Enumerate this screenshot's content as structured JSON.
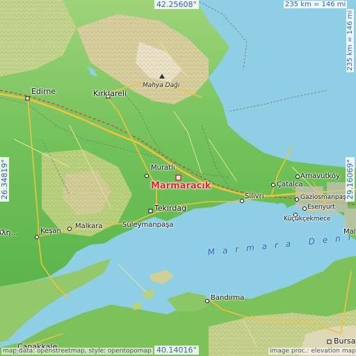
{
  "colors": {
    "water": "#8fcfe6",
    "lowland": "#5bb54a",
    "plain": "#8ccf6a",
    "hill": "#c9d99a",
    "highland": "#d9c9a0",
    "peak": "#f2ece0",
    "road_major": "#f3c23b",
    "road_minor": "#e7e0a0",
    "rail": "#d04a2e",
    "border": "#777777",
    "marker": "#e8202a",
    "coord_text": "#2d63b4"
  },
  "target": {
    "name": "Marmaracık",
    "marker_icon": "square-marker-icon"
  },
  "places": [
    {
      "name": "Edirne",
      "dot": true
    },
    {
      "name": "Kırklareli",
      "dot": true
    },
    {
      "name": "Muratlı",
      "dot": true
    },
    {
      "name": "Tekirdağ",
      "dot": true
    },
    {
      "name": "Süleymanpaşa",
      "dot": false
    },
    {
      "name": "Malkara",
      "dot": true
    },
    {
      "name": "Keşan",
      "dot": true
    },
    {
      "name": "Silivri",
      "dot": true
    },
    {
      "name": "Çatalca",
      "dot": true
    },
    {
      "name": "Arnavutköy",
      "dot": true
    },
    {
      "name": "Esenyurt",
      "dot": true
    },
    {
      "name": "Gaziosmanpaşa",
      "dot": true
    },
    {
      "name": "Küçükçekmece",
      "dot": true
    },
    {
      "name": "Bandırma",
      "dot": true
    },
    {
      "name": "Bursa",
      "dot": true
    },
    {
      "name": "Çanakkale",
      "dot": true
    },
    {
      "name": "Maltepe",
      "dot": false
    },
    {
      "name": "...όλη",
      "dot": true
    }
  ],
  "mountain": {
    "name": "Mahya Dağı",
    "icon": "peak-triangle-icon"
  },
  "sea_label": "Marmara Deniz",
  "coords": {
    "top": "42.25608°",
    "bottom": "40.14016°",
    "left": "26.34819°",
    "right": "29.16069°"
  },
  "scale": {
    "top": "235 km = 146 mi",
    "right": "235 km = 146 mi"
  },
  "attribution": {
    "left": "map data: openstreetmap, style: opentopomap",
    "right": "image proc.: elevation map"
  }
}
